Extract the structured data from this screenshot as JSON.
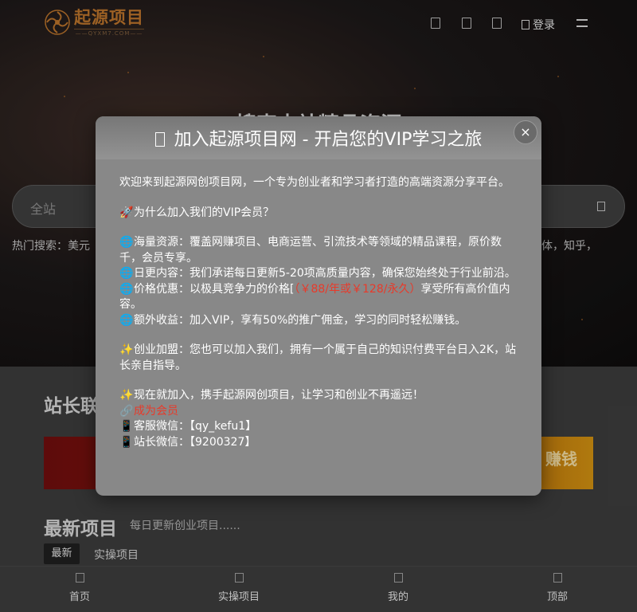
{
  "header": {
    "logo_title": "起源项目",
    "logo_sub": "——QYXM7.COM——",
    "login_label": "登录"
  },
  "hero": {
    "title": "搜索本站精品资源",
    "search_scope": "全站",
    "hot_prefix": "热门搜索：美元",
    "hot_suffix": "体，知乎，"
  },
  "content": {
    "section1_title": "站长联",
    "banner_text": "赚钱",
    "section2_title": "最新项目",
    "section2_subtitle": "每日更新创业项目......",
    "tab_latest": "最新",
    "tab_practice": "实操项目"
  },
  "bottom_nav": [
    {
      "label": "首页",
      "icon": "home-icon"
    },
    {
      "label": "实操项目",
      "icon": "project-icon"
    },
    {
      "label": "我的",
      "icon": "user-icon"
    },
    {
      "label": "顶部",
      "icon": "top-icon"
    }
  ],
  "modal": {
    "title": "加入起源项目网 - 开启您的VIP学习之旅",
    "close_label": "×",
    "intro": "欢迎来到起源网创项目网，一个专为创业者和学习者打造的高端资源分享平台。",
    "why_emoji": "🚀",
    "why": "为什么加入我们的VIP会员？",
    "benefit1_emoji": "🌐",
    "benefit1": "海量资源：覆盖网赚项目、电商运营、引流技术等领域的精品课程，原价数千，会员专享。",
    "benefit2_emoji": "🌐",
    "benefit2": "日更内容：我们承诺每日更新5-20项高质量内容，确保您始终处于行业前沿。",
    "benefit3_emoji": "🌐",
    "benefit3_pre": "价格优惠：以极具竞争力的价格[",
    "benefit3_price": "（￥88/年或￥128/永久）",
    "benefit3_post": "享受所有高价值内容。",
    "benefit4_emoji": "🌐",
    "benefit4": "额外收益：加入VIP，享有50%的推广佣金，学习的同时轻松赚钱。",
    "partner_emoji": "✨",
    "partner": "创业加盟：您也可以加入我们，拥有一个属于自己的知识付费平台日入2K，站长亲自指导。",
    "join_emoji": "✨",
    "join": "现在就加入，携手起源网创项目，让学习和创业不再遥远！",
    "link_emoji": "🔗",
    "become_member": "成为会员",
    "phone_emoji": "📱",
    "service_wechat": "客服微信：【qy_kefu1】",
    "owner_wechat": "站长微信：【9200327】"
  },
  "colors": {
    "accent_orange": "#b36f2a",
    "price_red": "#e83a2a",
    "modal_bg": "#888888"
  }
}
